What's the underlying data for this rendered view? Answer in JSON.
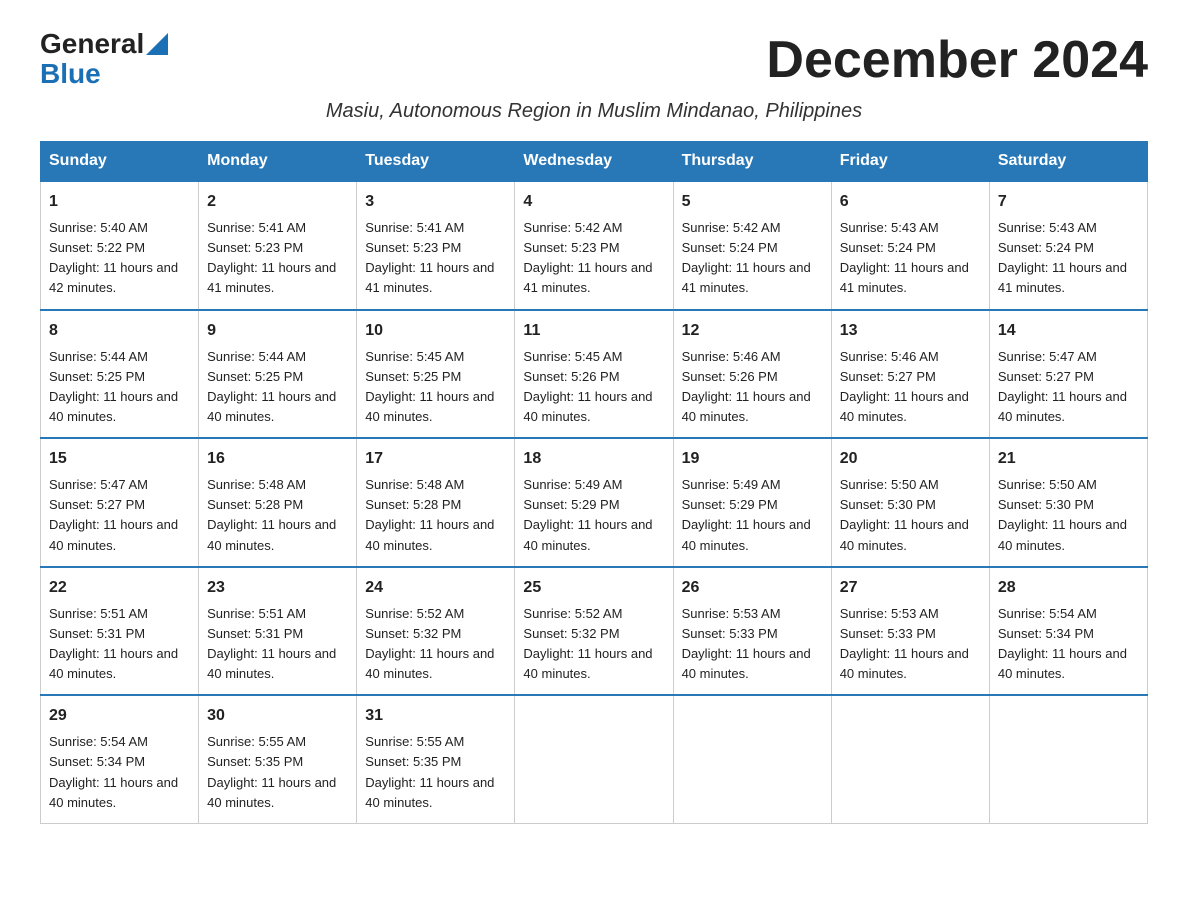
{
  "logo": {
    "general": "General",
    "blue": "Blue"
  },
  "title": "December 2024",
  "subtitle": "Masiu, Autonomous Region in Muslim Mindanao, Philippines",
  "headers": [
    "Sunday",
    "Monday",
    "Tuesday",
    "Wednesday",
    "Thursday",
    "Friday",
    "Saturday"
  ],
  "weeks": [
    [
      {
        "day": "1",
        "sunrise": "5:40 AM",
        "sunset": "5:22 PM",
        "daylight": "11 hours and 42 minutes."
      },
      {
        "day": "2",
        "sunrise": "5:41 AM",
        "sunset": "5:23 PM",
        "daylight": "11 hours and 41 minutes."
      },
      {
        "day": "3",
        "sunrise": "5:41 AM",
        "sunset": "5:23 PM",
        "daylight": "11 hours and 41 minutes."
      },
      {
        "day": "4",
        "sunrise": "5:42 AM",
        "sunset": "5:23 PM",
        "daylight": "11 hours and 41 minutes."
      },
      {
        "day": "5",
        "sunrise": "5:42 AM",
        "sunset": "5:24 PM",
        "daylight": "11 hours and 41 minutes."
      },
      {
        "day": "6",
        "sunrise": "5:43 AM",
        "sunset": "5:24 PM",
        "daylight": "11 hours and 41 minutes."
      },
      {
        "day": "7",
        "sunrise": "5:43 AM",
        "sunset": "5:24 PM",
        "daylight": "11 hours and 41 minutes."
      }
    ],
    [
      {
        "day": "8",
        "sunrise": "5:44 AM",
        "sunset": "5:25 PM",
        "daylight": "11 hours and 40 minutes."
      },
      {
        "day": "9",
        "sunrise": "5:44 AM",
        "sunset": "5:25 PM",
        "daylight": "11 hours and 40 minutes."
      },
      {
        "day": "10",
        "sunrise": "5:45 AM",
        "sunset": "5:25 PM",
        "daylight": "11 hours and 40 minutes."
      },
      {
        "day": "11",
        "sunrise": "5:45 AM",
        "sunset": "5:26 PM",
        "daylight": "11 hours and 40 minutes."
      },
      {
        "day": "12",
        "sunrise": "5:46 AM",
        "sunset": "5:26 PM",
        "daylight": "11 hours and 40 minutes."
      },
      {
        "day": "13",
        "sunrise": "5:46 AM",
        "sunset": "5:27 PM",
        "daylight": "11 hours and 40 minutes."
      },
      {
        "day": "14",
        "sunrise": "5:47 AM",
        "sunset": "5:27 PM",
        "daylight": "11 hours and 40 minutes."
      }
    ],
    [
      {
        "day": "15",
        "sunrise": "5:47 AM",
        "sunset": "5:27 PM",
        "daylight": "11 hours and 40 minutes."
      },
      {
        "day": "16",
        "sunrise": "5:48 AM",
        "sunset": "5:28 PM",
        "daylight": "11 hours and 40 minutes."
      },
      {
        "day": "17",
        "sunrise": "5:48 AM",
        "sunset": "5:28 PM",
        "daylight": "11 hours and 40 minutes."
      },
      {
        "day": "18",
        "sunrise": "5:49 AM",
        "sunset": "5:29 PM",
        "daylight": "11 hours and 40 minutes."
      },
      {
        "day": "19",
        "sunrise": "5:49 AM",
        "sunset": "5:29 PM",
        "daylight": "11 hours and 40 minutes."
      },
      {
        "day": "20",
        "sunrise": "5:50 AM",
        "sunset": "5:30 PM",
        "daylight": "11 hours and 40 minutes."
      },
      {
        "day": "21",
        "sunrise": "5:50 AM",
        "sunset": "5:30 PM",
        "daylight": "11 hours and 40 minutes."
      }
    ],
    [
      {
        "day": "22",
        "sunrise": "5:51 AM",
        "sunset": "5:31 PM",
        "daylight": "11 hours and 40 minutes."
      },
      {
        "day": "23",
        "sunrise": "5:51 AM",
        "sunset": "5:31 PM",
        "daylight": "11 hours and 40 minutes."
      },
      {
        "day": "24",
        "sunrise": "5:52 AM",
        "sunset": "5:32 PM",
        "daylight": "11 hours and 40 minutes."
      },
      {
        "day": "25",
        "sunrise": "5:52 AM",
        "sunset": "5:32 PM",
        "daylight": "11 hours and 40 minutes."
      },
      {
        "day": "26",
        "sunrise": "5:53 AM",
        "sunset": "5:33 PM",
        "daylight": "11 hours and 40 minutes."
      },
      {
        "day": "27",
        "sunrise": "5:53 AM",
        "sunset": "5:33 PM",
        "daylight": "11 hours and 40 minutes."
      },
      {
        "day": "28",
        "sunrise": "5:54 AM",
        "sunset": "5:34 PM",
        "daylight": "11 hours and 40 minutes."
      }
    ],
    [
      {
        "day": "29",
        "sunrise": "5:54 AM",
        "sunset": "5:34 PM",
        "daylight": "11 hours and 40 minutes."
      },
      {
        "day": "30",
        "sunrise": "5:55 AM",
        "sunset": "5:35 PM",
        "daylight": "11 hours and 40 minutes."
      },
      {
        "day": "31",
        "sunrise": "5:55 AM",
        "sunset": "5:35 PM",
        "daylight": "11 hours and 40 minutes."
      },
      null,
      null,
      null,
      null
    ]
  ]
}
